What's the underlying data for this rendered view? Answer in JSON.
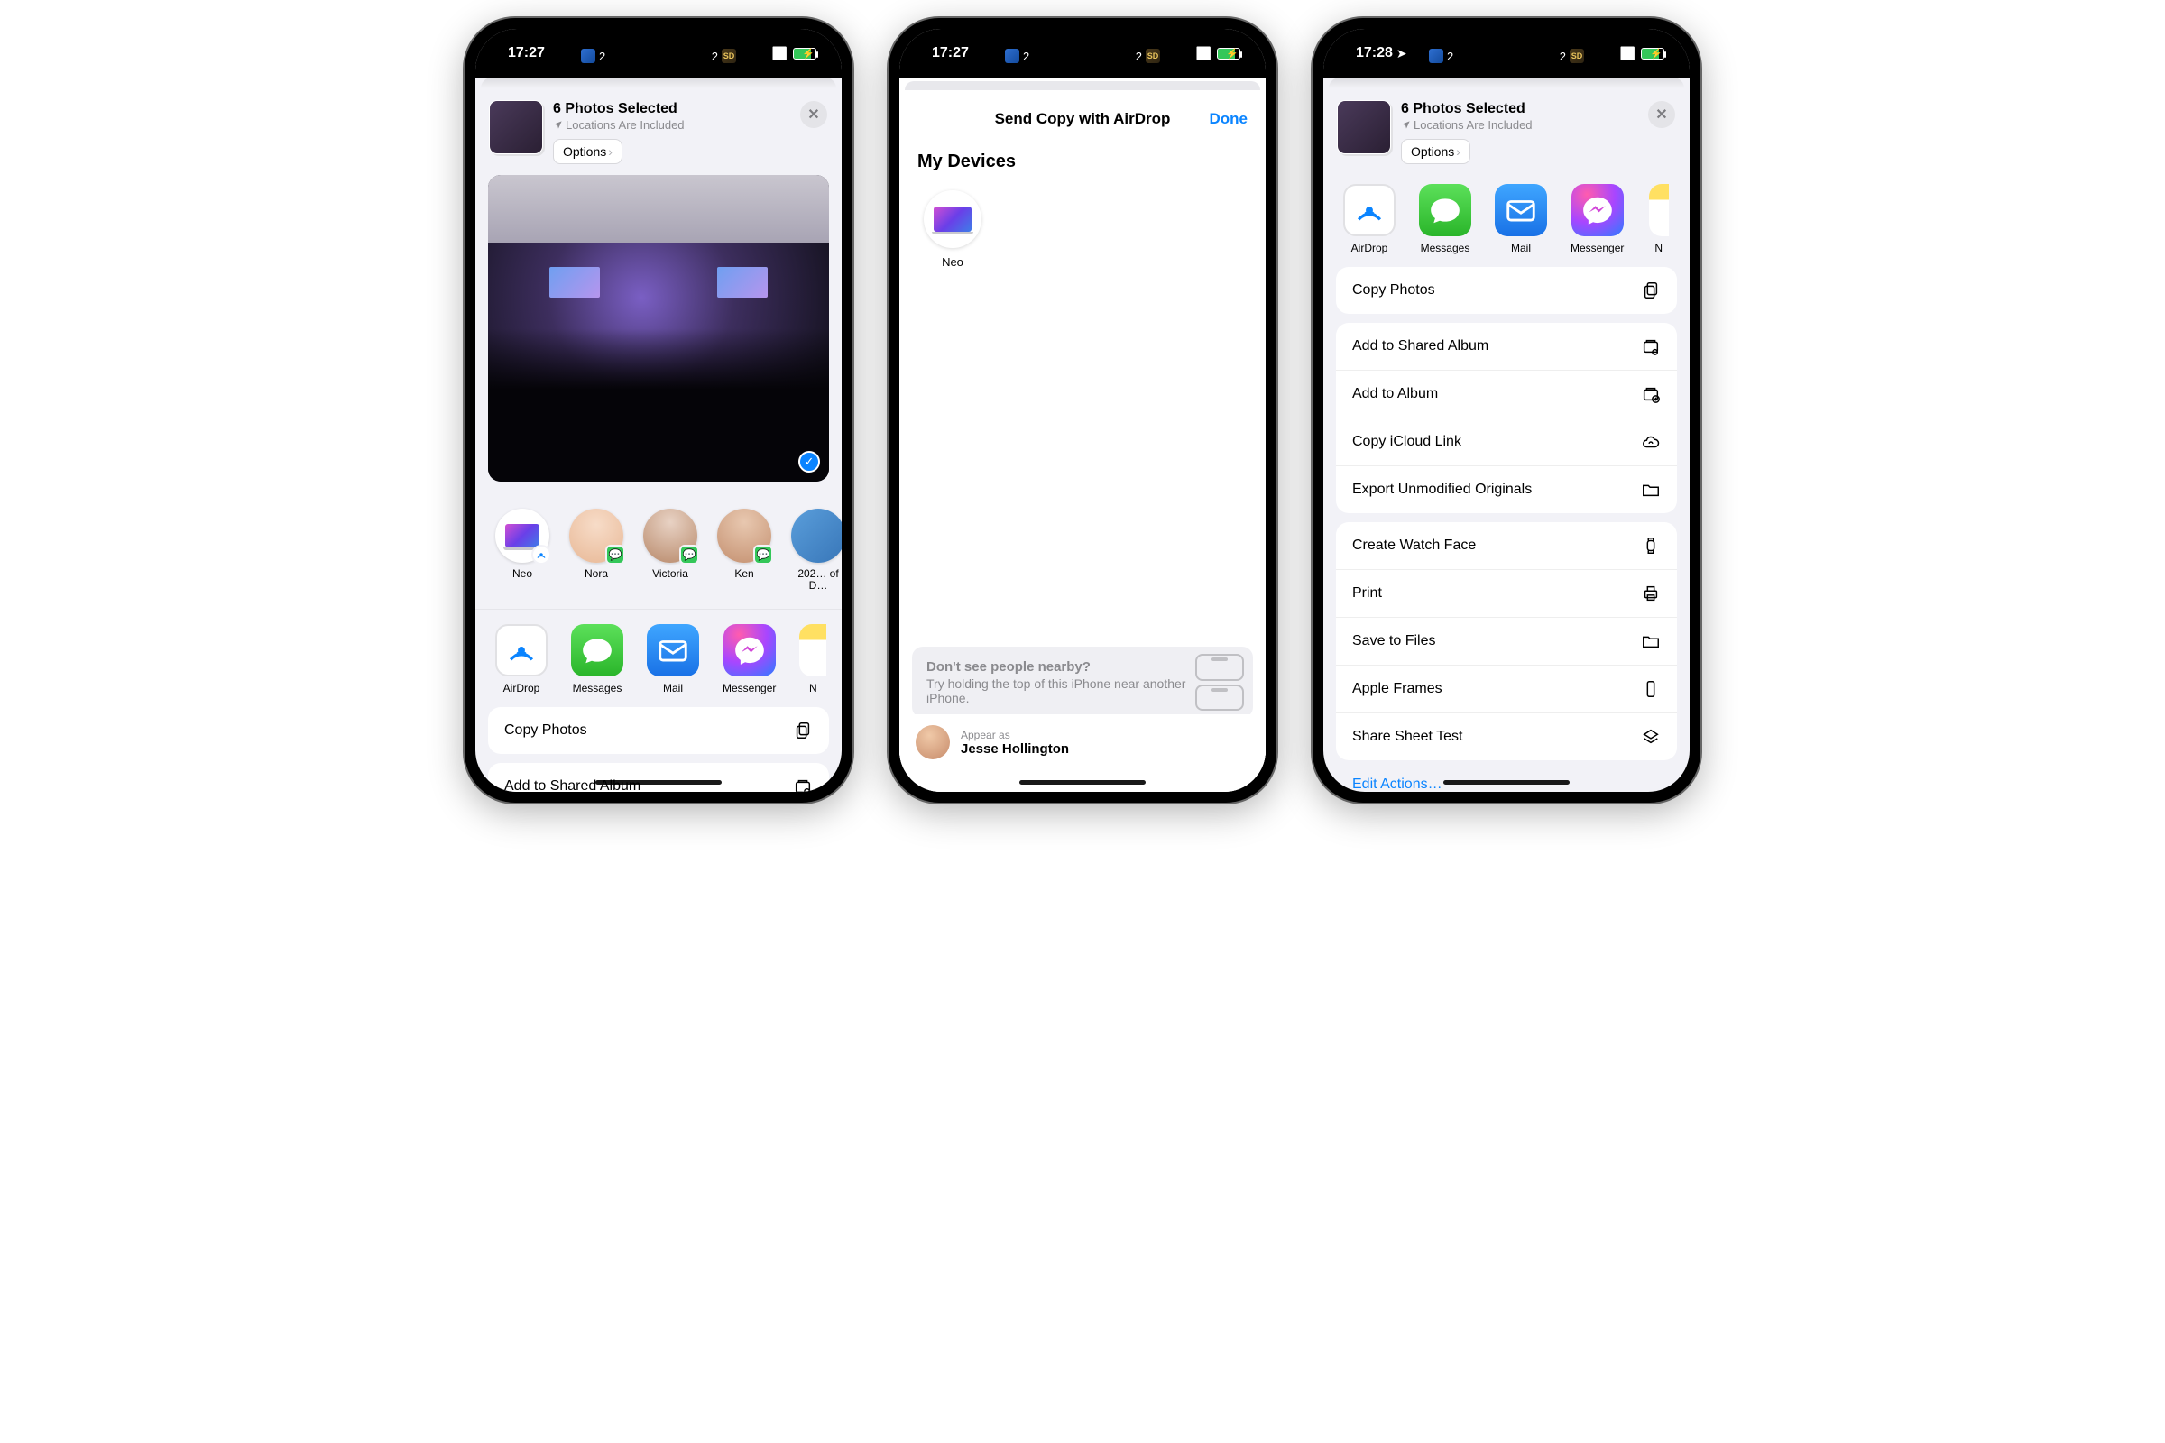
{
  "status": {
    "time1": "17:27",
    "time2": "17:27",
    "time3": "17:28",
    "score_left_team": "blue-jay",
    "score_left": "2",
    "score_right_team": "SD",
    "score_right": "2"
  },
  "share": {
    "title": "6 Photos Selected",
    "subtitle": "Locations Are Included",
    "options": "Options"
  },
  "people": [
    {
      "name": "Neo",
      "type": "mac"
    },
    {
      "name": "Nora",
      "type": "memoji",
      "badge": "messages"
    },
    {
      "name": "Victoria",
      "type": "photo",
      "badge": "messages"
    },
    {
      "name": "Ken",
      "type": "photo",
      "badge": "messages"
    },
    {
      "name": "202… of D…",
      "type": "photo"
    }
  ],
  "apps": [
    {
      "name": "AirDrop"
    },
    {
      "name": "Messages"
    },
    {
      "name": "Mail"
    },
    {
      "name": "Messenger"
    },
    {
      "name": "N"
    }
  ],
  "actions_top_visible": [
    {
      "label": "Copy Photos",
      "icon": "copy"
    },
    {
      "label": "Add to Shared Album",
      "icon": "shared-album"
    }
  ],
  "airdrop": {
    "title": "Send Copy with AirDrop",
    "done": "Done",
    "section": "My Devices",
    "device": "Neo",
    "hint_title": "Don't see people nearby?",
    "hint_body": "Try holding the top of this iPhone near another iPhone.",
    "appear_label": "Appear as",
    "appear_name": "Jesse Hollington"
  },
  "screen3": {
    "group1": [
      {
        "label": "Copy Photos",
        "icon": "copy"
      }
    ],
    "group2": [
      {
        "label": "Add to Shared Album",
        "icon": "shared-album"
      },
      {
        "label": "Add to Album",
        "icon": "album"
      },
      {
        "label": "Copy iCloud Link",
        "icon": "icloud"
      },
      {
        "label": "Export Unmodified Originals",
        "icon": "folder"
      }
    ],
    "group3": [
      {
        "label": "Create Watch Face",
        "icon": "watch"
      },
      {
        "label": "Print",
        "icon": "print"
      },
      {
        "label": "Save to Files",
        "icon": "folder"
      },
      {
        "label": "Apple Frames",
        "icon": "phone"
      },
      {
        "label": "Share Sheet Test",
        "icon": "layers"
      }
    ],
    "edit": "Edit Actions…"
  }
}
